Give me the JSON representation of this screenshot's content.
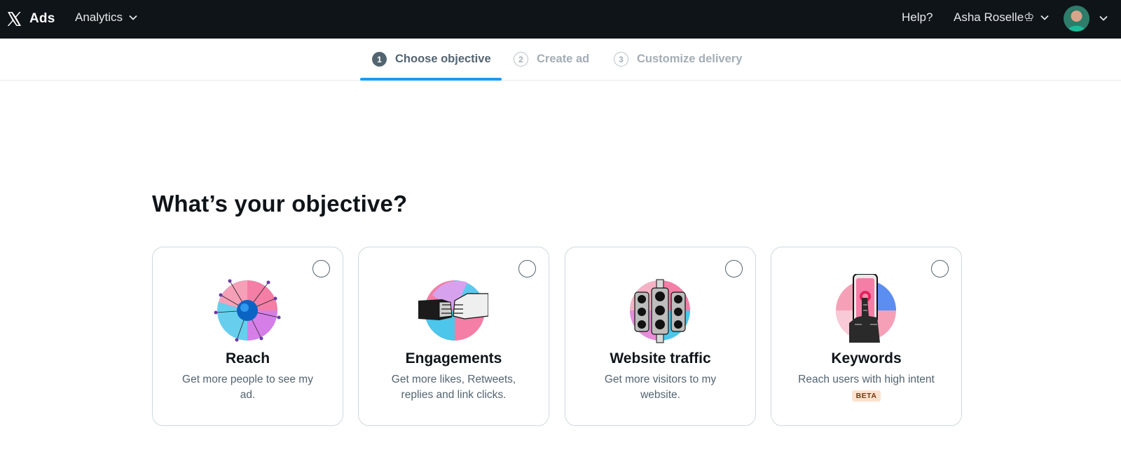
{
  "nav": {
    "brand": "Ads",
    "analytics": "Analytics",
    "help": "Help?",
    "user_name": "Asha Roselle♔"
  },
  "stepper": {
    "steps": [
      {
        "number": "1",
        "label": "Choose objective"
      },
      {
        "number": "2",
        "label": "Create ad"
      },
      {
        "number": "3",
        "label": "Customize delivery"
      }
    ]
  },
  "main": {
    "title": "What’s your objective?",
    "cards": [
      {
        "title": "Reach",
        "description": "Get more people to see my ad."
      },
      {
        "title": "Engagements",
        "description": "Get more likes, Retweets, replies and link clicks."
      },
      {
        "title": "Website traffic",
        "description": "Get more visitors to my website."
      },
      {
        "title": "Keywords",
        "description": "Reach users with high intent",
        "badge": "BETA"
      }
    ]
  },
  "colors": {
    "topbar": "#0f1419",
    "accent": "#1d9bf0",
    "muted_text": "#536471",
    "badge_bg": "#fde1cf"
  },
  "icons": [
    "x-logo-icon",
    "chevron-down-icon",
    "avatar-image",
    "radio-circle-icon"
  ]
}
